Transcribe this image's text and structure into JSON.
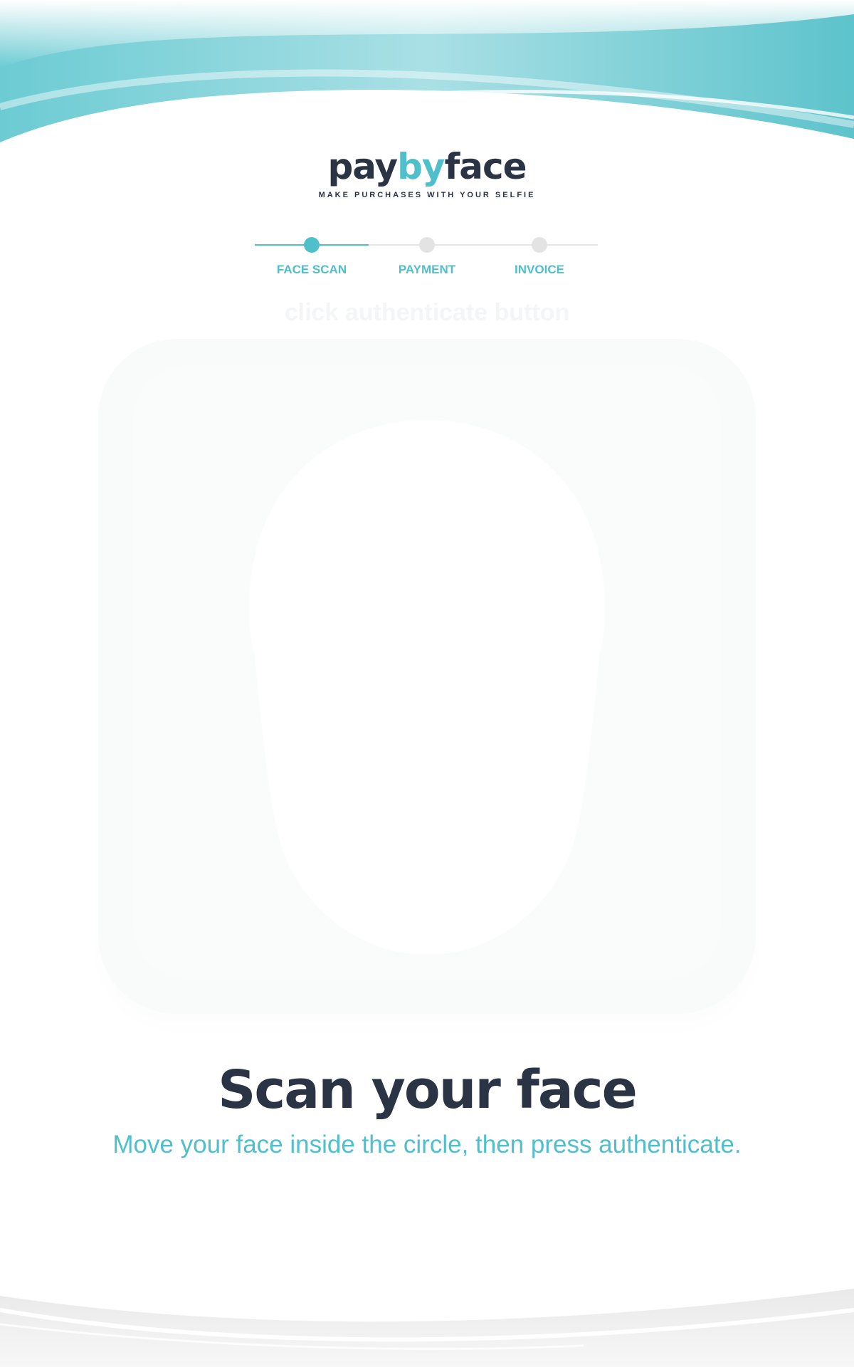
{
  "brand": {
    "logo_pay": "pay",
    "logo_by": "by",
    "logo_face": "face",
    "tagline": "MAKE PURCHASES WITH YOUR SELFIE",
    "primary_color": "#4fbfcb",
    "dark_color": "#2b3445"
  },
  "stepper": {
    "steps": [
      {
        "label": "FACE SCAN",
        "state": "active"
      },
      {
        "label": "PAYMENT",
        "state": "pending"
      },
      {
        "label": "INVOICE",
        "state": "pending"
      }
    ]
  },
  "camera": {
    "hint": "click authenticate button"
  },
  "main": {
    "title": "Scan your face",
    "subtitle": "Move your face inside the circle, then press authenticate."
  }
}
